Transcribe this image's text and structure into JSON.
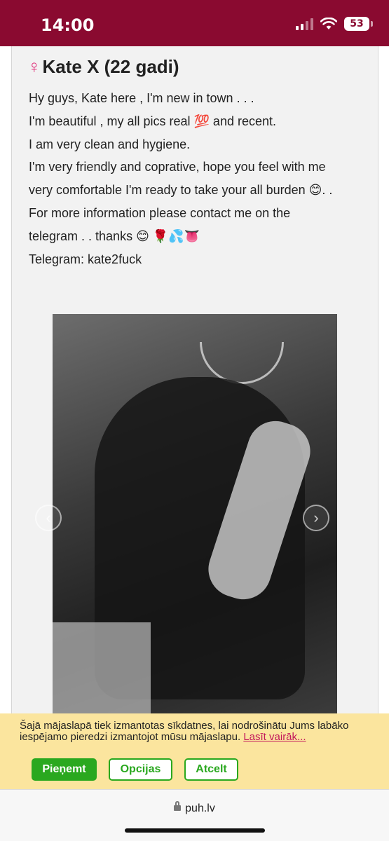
{
  "status_bar": {
    "time": "14:00",
    "battery": "53",
    "icons": [
      "cellular-signal-icon",
      "wifi-icon",
      "battery-icon"
    ]
  },
  "listing": {
    "title_icon": "♀",
    "title": "Kate X (22 gadi)",
    "description_lines": [
      "Hy guys, Kate here , I'm new in town . . .",
      "I'm beautiful , my all pics real 💯 and recent.",
      "I am very clean and hygiene.",
      "I'm very friendly and coprative, hope you feel with me",
      "very comfortable I'm ready to take your all burden 😊. .",
      "For more information please contact me on the",
      "telegram . . thanks 😊 🌹💦👅",
      "Telegram: kate2fuck"
    ]
  },
  "carousel": {
    "prev_symbol": "‹",
    "next_symbol": "›"
  },
  "cookie_banner": {
    "text": "Šajā mājaslapā tiek izmantotas sīkdatnes, lai nodrošinātu Jums labāko iespējamo pieredzi izmantojot mūsu mājaslapu.",
    "link": "Lasīt vairāk...",
    "accept": "Pieņemt",
    "options": "Opcijas",
    "cancel": "Atcelt",
    "accent_color": "#2aa81f",
    "background_color": "#fbe59e"
  },
  "browser": {
    "url": "puh.lv"
  },
  "colors": {
    "status_bar": "#8a0a30"
  }
}
